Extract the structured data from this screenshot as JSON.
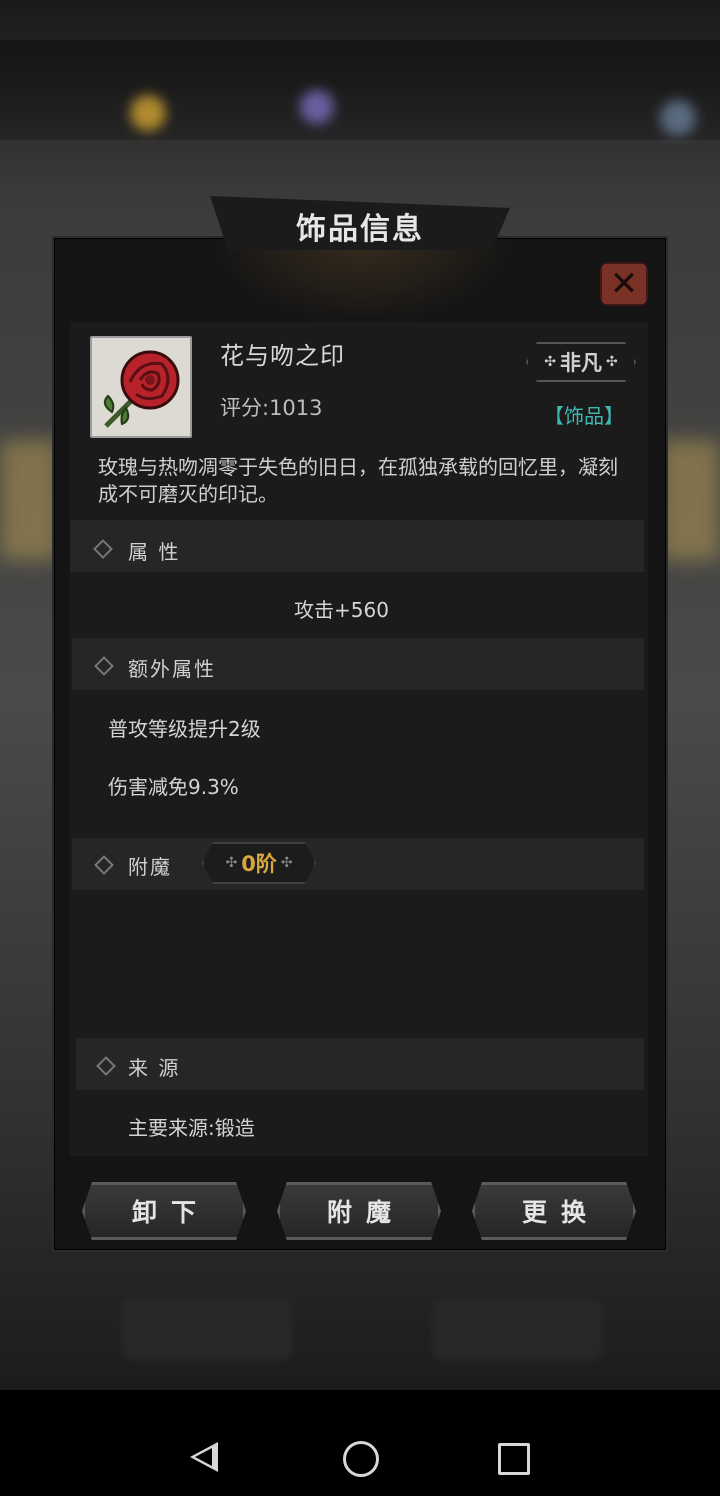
{
  "title": "饰品信息",
  "close_glyph": "✕",
  "item": {
    "name": "花与吻之印",
    "score": "评分:1013",
    "rarity": "非凡",
    "type": "【饰品】",
    "description": "玫瑰与热吻凋零于失色的旧日，在孤独承载的回忆里，凝刻成不可磨灭的印记。",
    "icon": "rose-icon"
  },
  "sections": {
    "attributes": {
      "label": "属 性",
      "value": "攻击+560"
    },
    "extra": {
      "label": "额外属性",
      "lines": [
        "普攻等级提升2级",
        "伤害减免9.3%"
      ]
    },
    "enchant": {
      "label": "附魔",
      "tier": "0阶"
    },
    "source": {
      "label": "来 源",
      "value": "主要来源:锻造"
    }
  },
  "buttons": {
    "unequip": "卸下",
    "enchant": "附魔",
    "replace": "更换"
  },
  "colors": {
    "accent_teal": "#3eb7b0",
    "tier_gold": "#d7a63d",
    "close_red": "#7a3226"
  }
}
